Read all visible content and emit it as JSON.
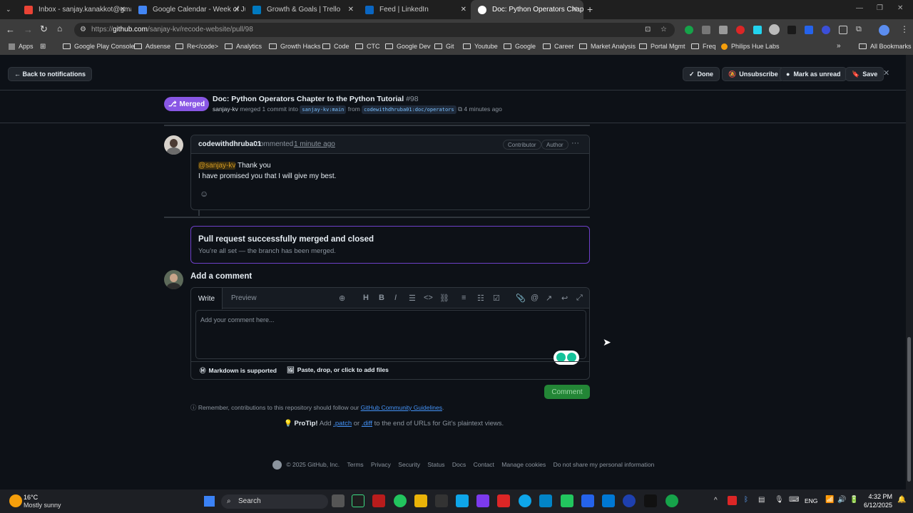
{
  "browser": {
    "tabs": [
      {
        "label": "Inbox - sanjay.kanakkot@gmail.",
        "color": "#ea4335"
      },
      {
        "label": "Google Calendar - Week of Jun",
        "color": "#4285f4"
      },
      {
        "label": "Growth & Goals | Trello",
        "color": "#0079bf"
      },
      {
        "label": "Feed | LinkedIn",
        "color": "#0a66c2"
      },
      {
        "label": "Doc: Python Operators Chapter",
        "color": "#ffffff"
      }
    ],
    "url_prefix": "https://",
    "url_host": "github.com",
    "url_path": "/sanjay-kv/recode-website/pull/98",
    "bookmarks": [
      "Apps",
      "Google Play Console",
      "Adsense",
      "Re</code>",
      "Analytics",
      "Growth Hacks",
      "Code",
      "CTC",
      "Google Dev",
      "Git",
      "Youtube",
      "Google",
      "Career",
      "Market Analysis",
      "Portal Mgmt",
      "Freq",
      "Philips Hue Labs"
    ],
    "all_bookmarks": "All Bookmarks"
  },
  "notifications": {
    "back": "← Back to notifications",
    "done": "Done",
    "unsubscribe": "Unsubscribe",
    "mark_unread": "Mark as unread",
    "save": "Save"
  },
  "pr": {
    "state": "Merged",
    "title": "Doc: Python Operators Chapter to the Python Tutorial",
    "number": "#98",
    "author": "sanjay-kv",
    "merge_text": "merged 1 commit into",
    "base": "sanjay-kv:main",
    "from": "from",
    "head": "codewithdhruba01:doc/operators",
    "time": "4 minutes ago"
  },
  "comment": {
    "user": "codewithdhruba01",
    "action": "commented",
    "time": "1 minute ago",
    "badge_contributor": "Contributor",
    "badge_author": "Author",
    "mention": "@sanjay-kv",
    "line1": "Thank you",
    "line2": "I have promised you that I will give my best."
  },
  "merged_box": {
    "title": "Pull request successfully merged and closed",
    "text": "You’re all set — the branch has been merged."
  },
  "new_comment": {
    "heading": "Add a comment",
    "tab_write": "Write",
    "tab_preview": "Preview",
    "placeholder": "Add your comment here...",
    "markdown": "Markdown is supported",
    "attach": "Paste, drop, or click to add files",
    "submit": "Comment"
  },
  "guidelines": {
    "text": "Remember, contributions to this repository should follow our",
    "link": "GitHub Community Guidelines",
    "end": "."
  },
  "protip": {
    "label": "ProTip!",
    "a": "Add",
    "patch": ".patch",
    "or": "or",
    "diff": ".diff",
    "rest": "to the end of URLs for Git’s plaintext views."
  },
  "footer": {
    "copyright": "© 2025 GitHub, Inc.",
    "links": [
      "Terms",
      "Privacy",
      "Security",
      "Status",
      "Docs",
      "Contact",
      "Manage cookies",
      "Do not share my personal information"
    ]
  },
  "taskbar": {
    "temp": "16°C",
    "weather": "Mostly sunny",
    "search": "Search",
    "lang": "ENG",
    "time": "4:32 PM",
    "date": "6/12/2025"
  }
}
